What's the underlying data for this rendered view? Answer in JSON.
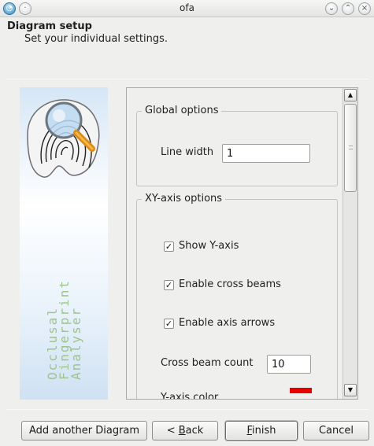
{
  "window": {
    "title": "ofa",
    "controls": [
      "app-icon",
      "menu-icon",
      "minimize-icon",
      "maximize-icon",
      "close-icon"
    ]
  },
  "header": {
    "title": "Diagram setup",
    "subtitle": "Set your individual settings."
  },
  "side_image": {
    "brand_lines": [
      "Occlusal",
      "Fingerprint",
      "Analyser"
    ],
    "icon": "magnifier-over-fingerprint"
  },
  "global_options": {
    "title": "Global options",
    "line_width_label": "Line width",
    "line_width_value": "1"
  },
  "xy_axis_options": {
    "title": "XY-axis options",
    "show_y_axis": {
      "label": "Show Y-axis",
      "checked": true
    },
    "enable_cross_beams": {
      "label": "Enable cross beams",
      "checked": true
    },
    "enable_axis_arrows": {
      "label": "Enable axis arrows",
      "checked": true
    },
    "cross_beam_count_label": "Cross beam count",
    "cross_beam_count_value": "10",
    "partial_row_label": "Y-axis color",
    "partial_row_color": "#e60000"
  },
  "buttons": {
    "add_another": "Add another Diagram",
    "back_prefix": "< ",
    "back_mnemonic": "B",
    "back_rest": "ack",
    "finish_mnemonic": "F",
    "finish_rest": "inish",
    "cancel": "Cancel"
  }
}
